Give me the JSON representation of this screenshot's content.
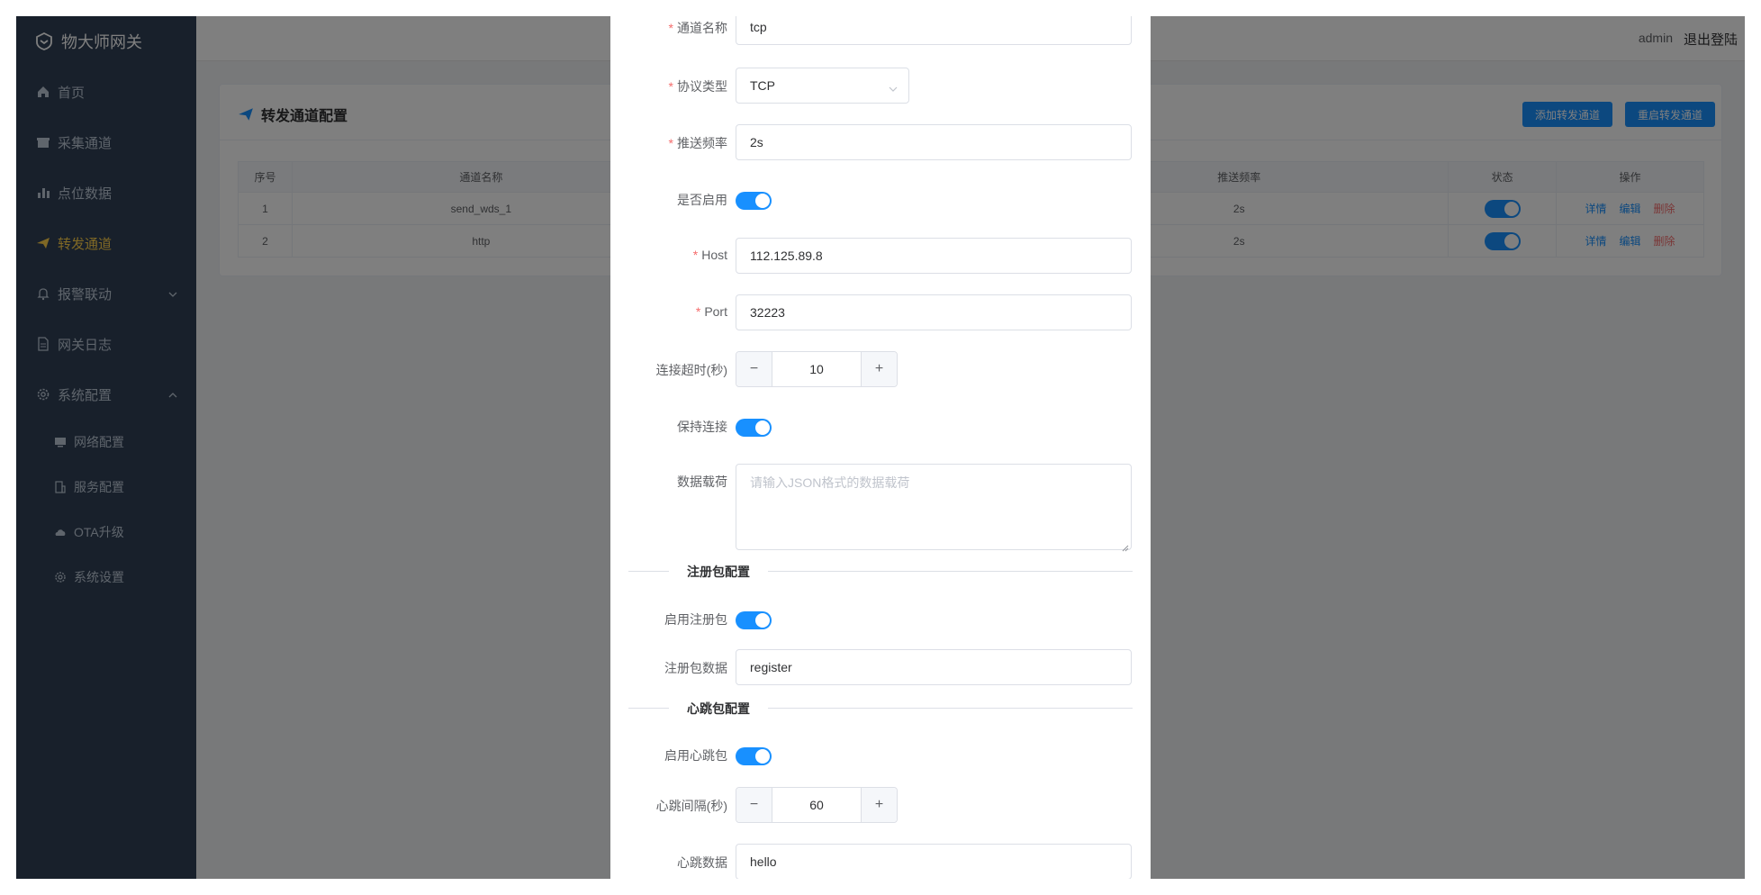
{
  "sidebar": {
    "logo": "物大师网关",
    "items": [
      {
        "label": "首页",
        "icon": "home-icon"
      },
      {
        "label": "采集通道",
        "icon": "box-icon"
      },
      {
        "label": "点位数据",
        "icon": "bar-chart-icon"
      },
      {
        "label": "转发通道",
        "icon": "send-icon",
        "active": true
      },
      {
        "label": "报警联动",
        "icon": "bell-icon"
      },
      {
        "label": "网关日志",
        "icon": "document-icon"
      },
      {
        "label": "系统配置",
        "icon": "gear-icon"
      }
    ],
    "subitems": [
      {
        "label": "网络配置",
        "icon": "monitor-icon"
      },
      {
        "label": "服务配置",
        "icon": "office-icon"
      },
      {
        "label": "OTA升级",
        "icon": "cloud-upload-icon"
      },
      {
        "label": "系统设置",
        "icon": "settings-icon"
      }
    ]
  },
  "header": {
    "user": "admin",
    "logout": "退出登陆"
  },
  "card": {
    "title": "转发通道配置",
    "add_button": "添加转发通道",
    "restart_button": "重启转发通道",
    "columns": [
      "序号",
      "通道名称",
      "推送频率",
      "状态",
      "操作"
    ],
    "rows": [
      {
        "index": "1",
        "name": "send_wds_1",
        "freq": "2s",
        "enabled": true
      },
      {
        "index": "2",
        "name": "http",
        "freq": "2s",
        "enabled": true
      }
    ],
    "ops": {
      "detail": "详情",
      "edit": "编辑",
      "delete": "删除"
    }
  },
  "dialog": {
    "channel_name": {
      "label": "通道名称",
      "value": "tcp"
    },
    "protocol": {
      "label": "协议类型",
      "value": "TCP"
    },
    "frequency": {
      "label": "推送频率",
      "value": "2s"
    },
    "enabled": {
      "label": "是否启用",
      "on": true
    },
    "host": {
      "label": "Host",
      "value": "112.125.89.8"
    },
    "port": {
      "label": "Port",
      "value": "32223"
    },
    "timeout": {
      "label": "连接超时(秒)",
      "value": "10"
    },
    "keepalive": {
      "label": "保持连接",
      "on": true
    },
    "payload": {
      "label": "数据载荷",
      "placeholder": "请输入JSON格式的数据载荷"
    },
    "register_section": "注册包配置",
    "register_enabled": {
      "label": "启用注册包",
      "on": true
    },
    "register_data": {
      "label": "注册包数据",
      "value": "register"
    },
    "heartbeat_section": "心跳包配置",
    "heartbeat_enabled": {
      "label": "启用心跳包",
      "on": true
    },
    "heartbeat_interval": {
      "label": "心跳间隔(秒)",
      "value": "60"
    },
    "heartbeat_data": {
      "label": "心跳数据",
      "value": "hello"
    }
  },
  "colors": {
    "sidebar": "#304156",
    "active_menu": "#ffd04b",
    "primary": "#1890ff",
    "danger": "#f56c6c"
  }
}
